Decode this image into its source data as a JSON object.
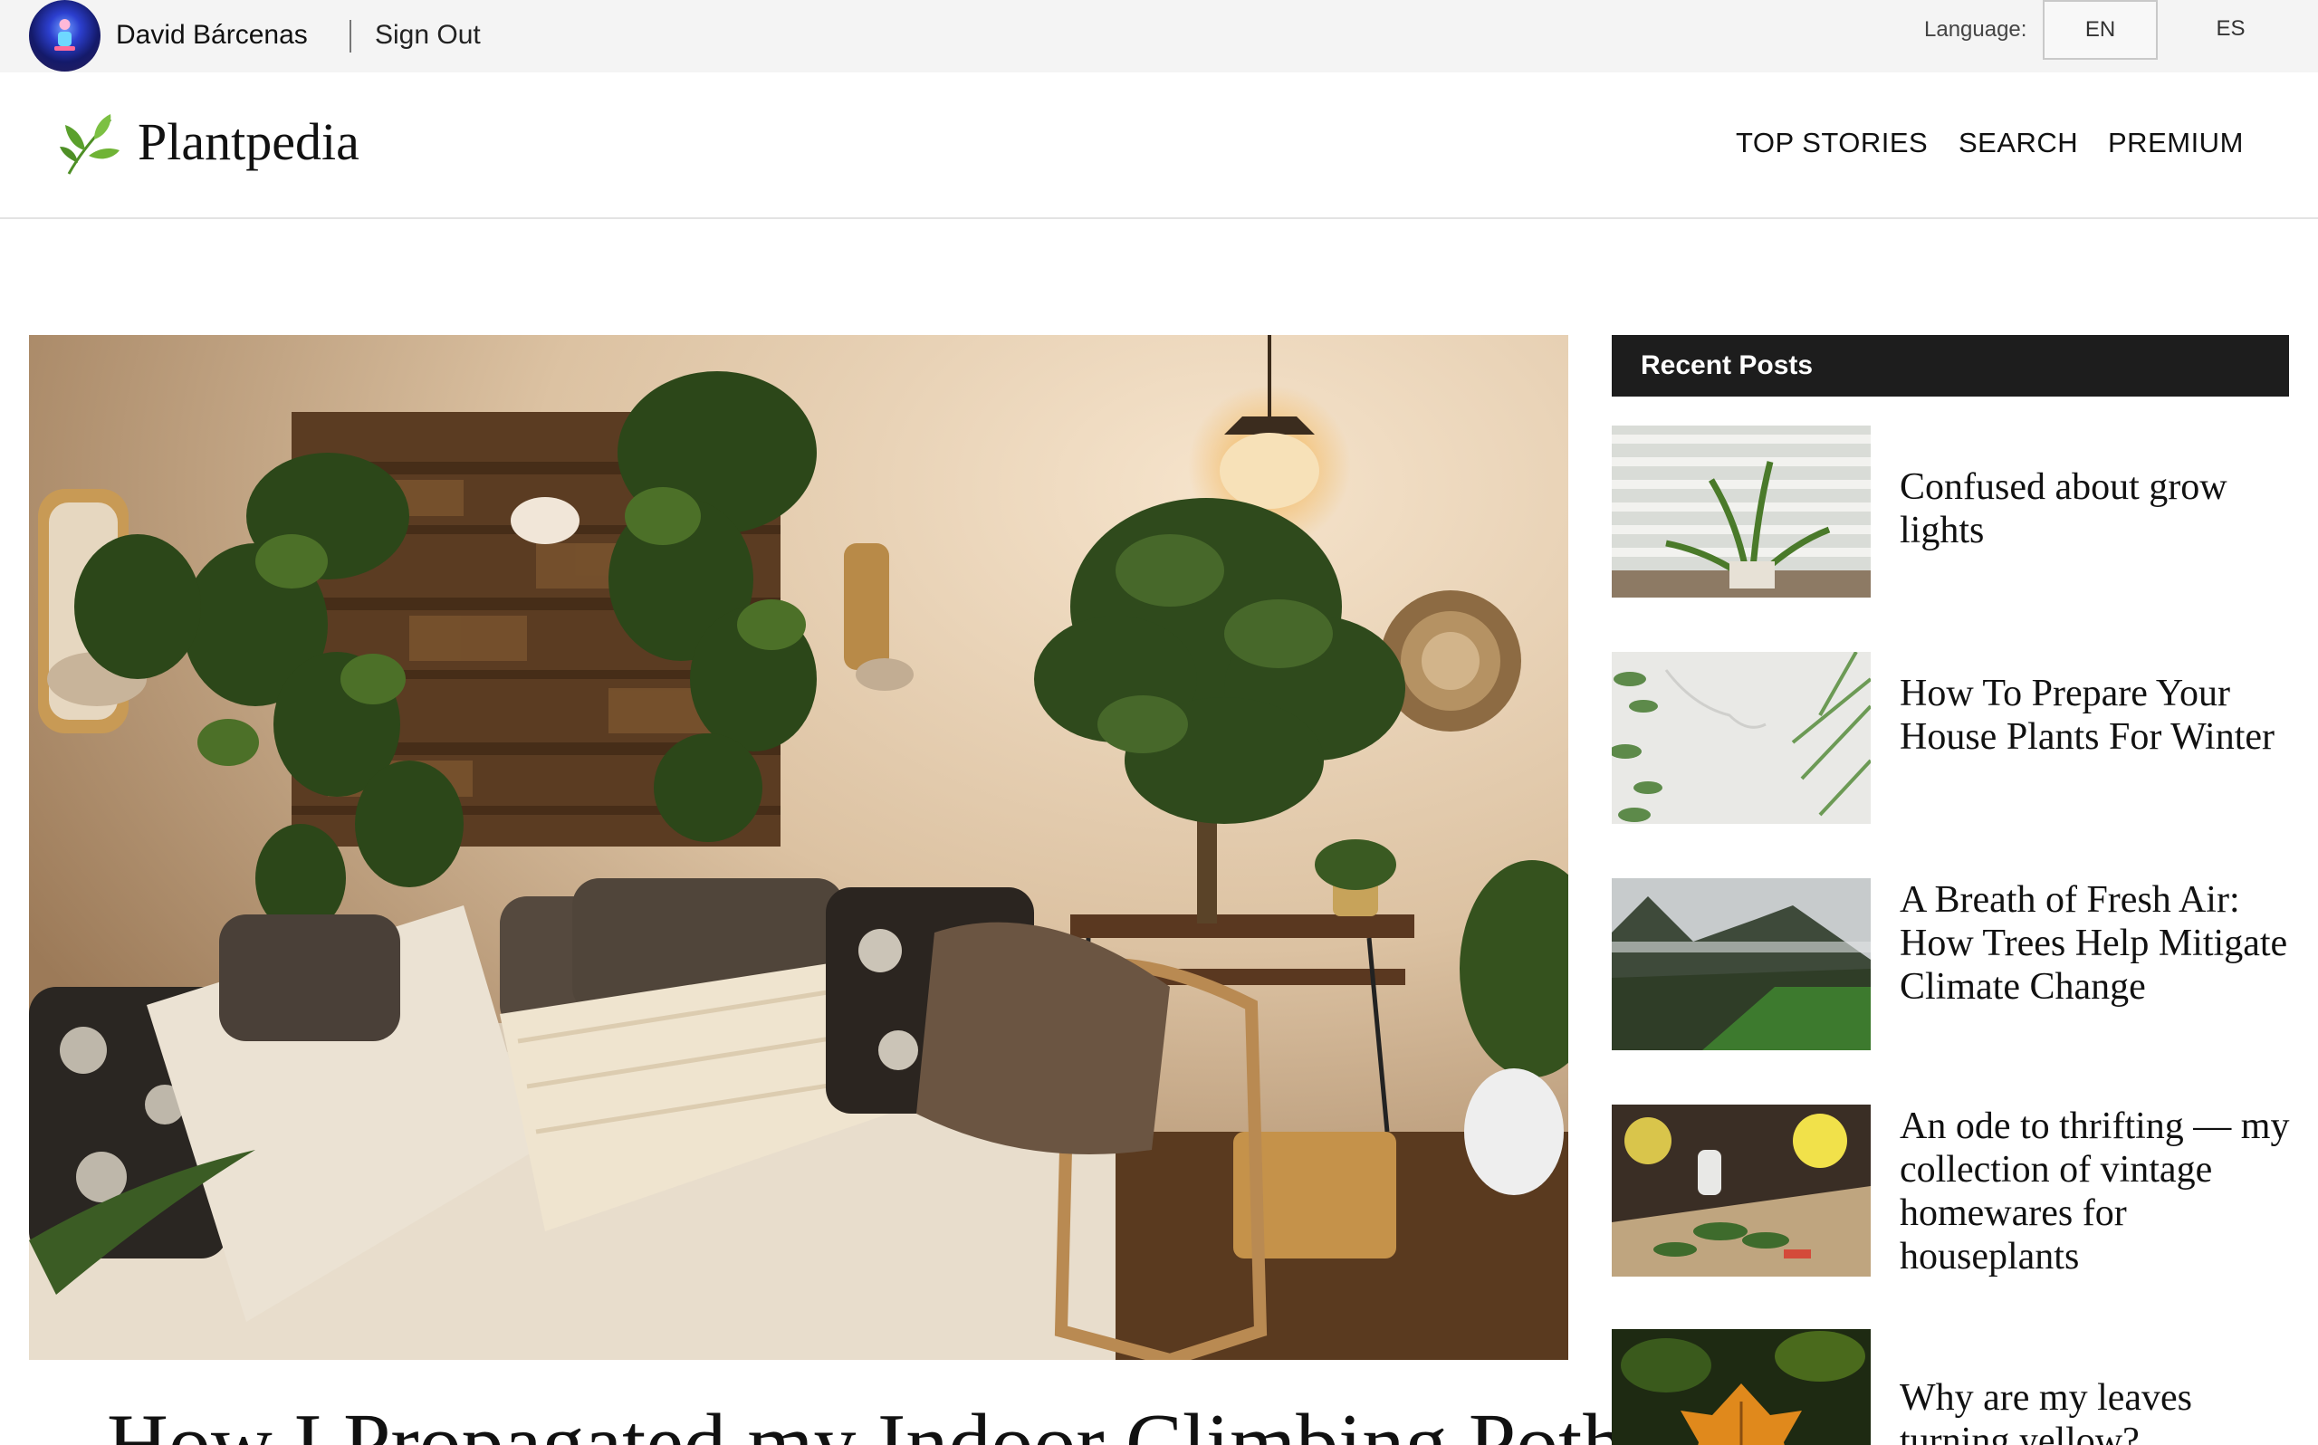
{
  "user_bar": {
    "username": "David Bárcenas",
    "sign_out": "Sign Out",
    "language_label": "Language:",
    "languages": [
      "EN",
      "ES"
    ],
    "active_language": "EN"
  },
  "header": {
    "brand": "Plantpedia",
    "nav": [
      "TOP STORIES",
      "SEARCH",
      "PREMIUM"
    ]
  },
  "hero": {
    "image_alt": "Living room with hanging pothos plants, a money tree, a lamp and a daybed with pillows",
    "title": "How I Propagated my Indoor Climbing Pothos"
  },
  "sidebar": {
    "heading": "Recent Posts",
    "posts": [
      {
        "title": "Confused about grow lights"
      },
      {
        "title": "How To Prepare Your House Plants For Winter"
      },
      {
        "title": "A Breath of Fresh Air: How Trees Help Mitigate Climate Change"
      },
      {
        "title": "An ode to thrifting — my collection of vintage homewares for houseplants"
      },
      {
        "title": "Why are my leaves turning yellow?"
      }
    ]
  },
  "colors": {
    "topbar_bg": "#f4f4f4",
    "sidebar_heading_bg": "#1d1d1d",
    "logo_green": "#5aa02c"
  }
}
